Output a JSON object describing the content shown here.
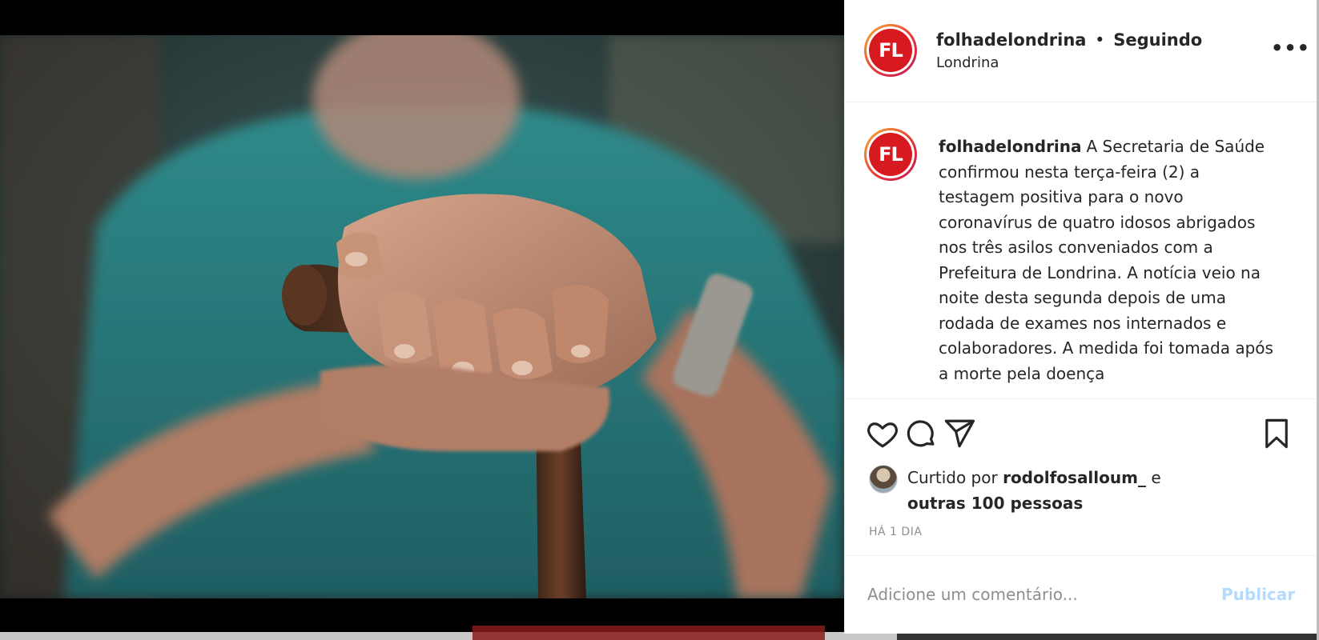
{
  "post": {
    "username": "folhadelondrina",
    "separator": "•",
    "follow_state": "Seguindo",
    "location": "Londrina",
    "avatar_text": "FL",
    "more_label": "•••"
  },
  "caption": {
    "username": "folhadelondrina",
    "text": "A Secretaria de Saúde confirmou nesta terça-feira (2) a testagem positiva para o novo coronavírus de quatro idosos abrigados nos três asilos conveniados com a Prefeitura de Londrina. A notícia veio na noite desta segunda depois de uma rodada de exames nos internados e colaboradores. A medida foi tomada após a morte pela doença"
  },
  "actions": {
    "like_icon": "heart-icon",
    "comment_icon": "comment-icon",
    "share_icon": "send-icon",
    "save_icon": "bookmark-icon"
  },
  "likes": {
    "prefix": "Curtido por",
    "user": "rodolfosalloum_",
    "conj": "e",
    "others": "outras 100 pessoas"
  },
  "timestamp": "HÁ 1 DIA",
  "comment": {
    "placeholder": "Adicione um comentário...",
    "publish_label": "Publicar"
  },
  "colors": {
    "brand_red": "#d71920",
    "text": "#262626",
    "muted": "#8e8e8e",
    "publish_disabled": "#b3dbff"
  }
}
